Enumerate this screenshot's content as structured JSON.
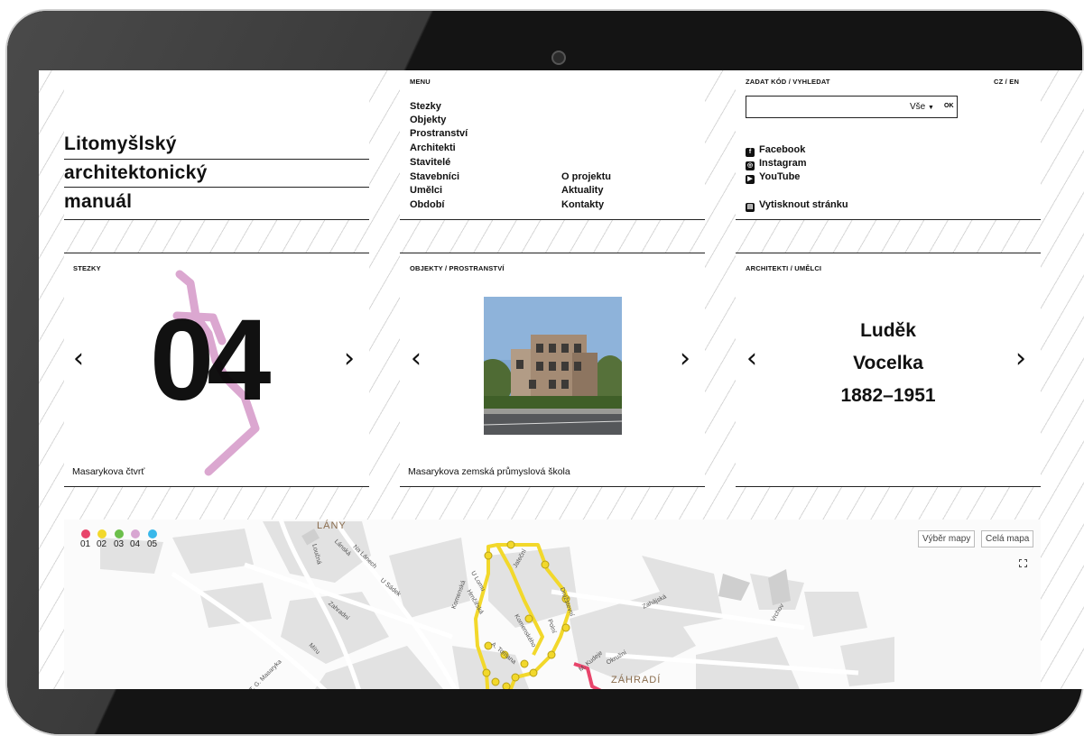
{
  "site": {
    "title_lines": [
      "Litomyšlský",
      "architektonický",
      "manuál"
    ]
  },
  "menu": {
    "heading": "MENU",
    "col1": [
      "Stezky",
      "Objekty",
      "Prostranství",
      "Architekti",
      "Stavitelé",
      "Stavebníci",
      "Umělci",
      "Období"
    ],
    "col2": [
      "O projektu",
      "Aktuality",
      "Kontakty"
    ]
  },
  "search": {
    "heading": "ZADAT KÓD / VYHLEDAT",
    "value": "",
    "filter_label": "Vše",
    "ok_label": "OK",
    "lang_label": "CZ / EN"
  },
  "social": {
    "facebook": "Facebook",
    "instagram": "Instagram",
    "youtube": "YouTube",
    "print": "Vytisknout stránku"
  },
  "trails": {
    "heading": "STEZKY",
    "number": "04",
    "caption": "Masarykova čtvrť",
    "trail_color": "#dba7d0"
  },
  "objects": {
    "heading": "OBJEKTY / PROSTRANSTVÍ",
    "caption": "Masarykova zemská průmyslová škola"
  },
  "architects": {
    "heading": "ARCHITEKTI / UMĚLCI",
    "name_lines": [
      "Luděk",
      "Vocelka",
      "1882–1951"
    ]
  },
  "map": {
    "legend": [
      {
        "label": "01",
        "color": "#e8456b"
      },
      {
        "label": "02",
        "color": "#f2d82b"
      },
      {
        "label": "03",
        "color": "#6cbf4b"
      },
      {
        "label": "04",
        "color": "#d8a6d2"
      },
      {
        "label": "05",
        "color": "#39b8ea"
      }
    ],
    "select_map_label": "Výběr mapy",
    "full_map_label": "Celá mapa",
    "fullscreen_icon": "fullscreen-icon",
    "place_labels": [
      "LÁNY",
      "ZÁHRADÍ"
    ],
    "street_labels": [
      "Lánská",
      "Na Lánech",
      "Loučná",
      "Zahradní",
      "U Sádek",
      "Míru",
      "T. G. Masaryka",
      "Jateční",
      "Komenská",
      "U Lomu",
      "Hrnčířská",
      "Družstevní",
      "Polní",
      "Komenského",
      "A. Tomana",
      "Zahájská",
      "Okružní",
      "M. Kudeje",
      "Vrchov"
    ],
    "trail_yellow": "#f2d82b",
    "trail_pink": "#e8456b"
  },
  "ui": {
    "prev_arrow": "‹",
    "next_arrow": "›",
    "accent": "#111111"
  }
}
